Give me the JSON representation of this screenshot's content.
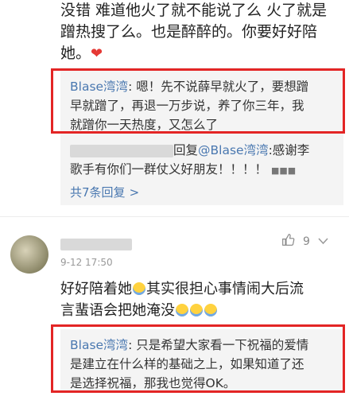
{
  "comment1": {
    "text_line1": "没错 难道他火了就不能说了么 火了就是",
    "text_line2": "蹭热搜了么。也是醉醉的。你要好好陪",
    "text_line3": "她。",
    "heart": "❤"
  },
  "reply1": {
    "user": "Blase湾湾",
    "text_line1": ": 嗯！先不说薛早就火了，要想蹭",
    "text_line2": "早就蹭了，再退一万步说，养了你三年，我",
    "text_line3": "就蹭你一天热度，又怎么了"
  },
  "reply2": {
    "prefix": "回复",
    "mention": "@Blase湾湾",
    "text_line1": ":感谢李",
    "text_line2": "歌手有你们一群仗义好朋友！！！！",
    "tail": "■■■"
  },
  "more_replies": {
    "label": "共7条回复",
    "chevron": ">"
  },
  "comment2": {
    "time": "9-12 17:50",
    "like_count": "9",
    "text_line1": "好好陪着她",
    "text_line1b": "其实很担心事情闹大后流",
    "text_line2": "言蜚语会把她淹没"
  },
  "reply3": {
    "user": "Blase湾湾",
    "text_line1": ": 只是希望大家看一下祝福的爱情",
    "text_line2": "是建立在什么样的基础之上，如果知道了还",
    "text_line3": "是选择祝福，那我也觉得OK。"
  },
  "colors": {
    "highlight": "#e32525",
    "link": "#4a78b0"
  }
}
